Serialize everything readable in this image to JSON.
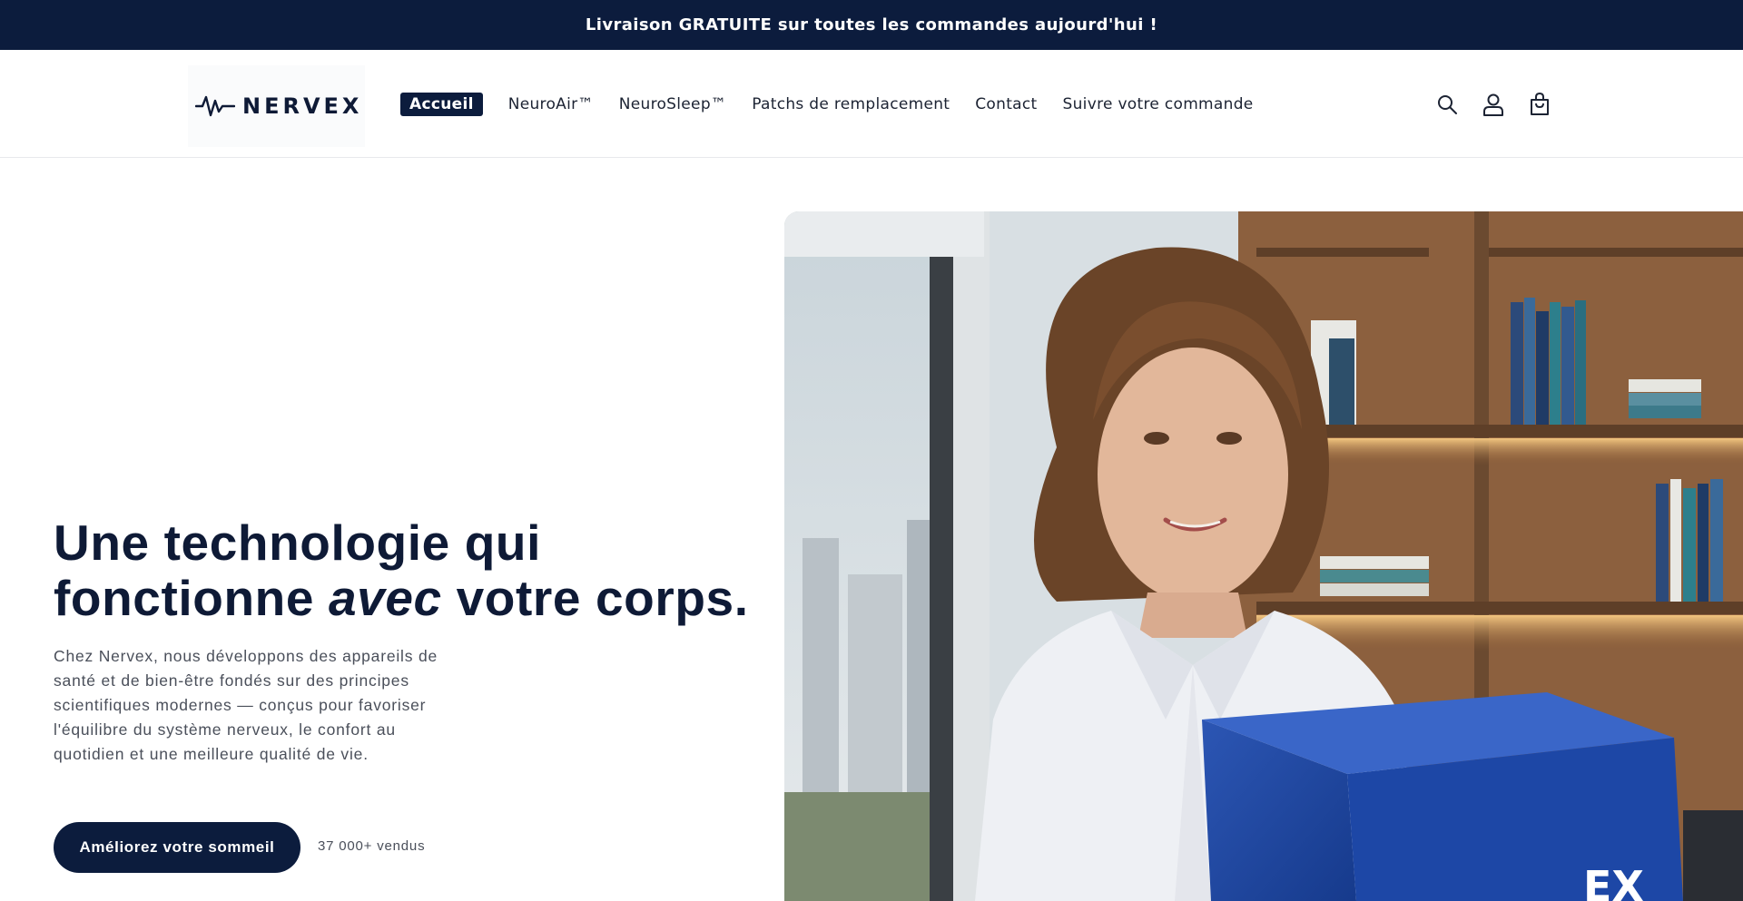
{
  "announcement": {
    "text": "Livraison GRATUITE sur toutes les commandes aujourd'hui !"
  },
  "header": {
    "logo_text": "NERVEX",
    "nav": [
      {
        "label": "Accueil",
        "active": true
      },
      {
        "label": "NeuroAir™",
        "active": false
      },
      {
        "label": "NeuroSleep™",
        "active": false
      },
      {
        "label": "Patchs de remplacement",
        "active": false
      },
      {
        "label": "Contact",
        "active": false
      },
      {
        "label": "Suivre votre commande",
        "active": false
      }
    ],
    "icons": [
      "search-icon",
      "account-icon",
      "cart-icon"
    ]
  },
  "hero": {
    "title_line1": "Une technologie qui",
    "title_line2_before": "fonctionne ",
    "title_line2_em": "avec",
    "title_line2_after": " votre corps.",
    "description": "Chez Nervex, nous développons des appareils de santé et de bien-être fondés sur des principes scientifiques modernes — conçus pour favoriser l'équilibre du système nerveux, le confort au quotidien et une meilleure qualité de vie.",
    "cta_label": "Améliorez votre sommeil",
    "sold_text": "37 000+ vendus"
  },
  "colors": {
    "primary": "#0c1c3d",
    "text": "#0e1a36",
    "muted": "#4a4f5a"
  }
}
